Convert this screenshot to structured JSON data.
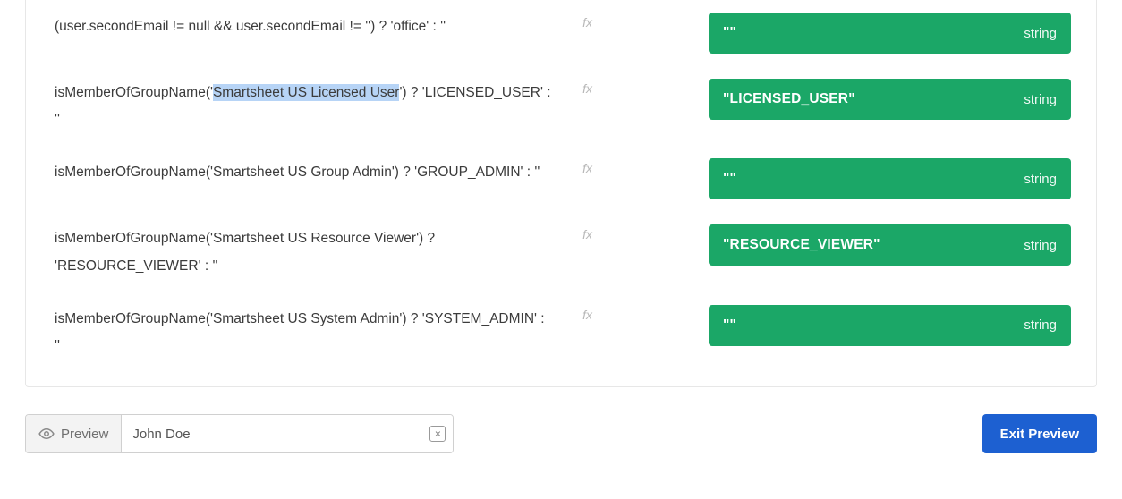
{
  "rows": [
    {
      "expr_pre": "(user.secondEmail != null && user.secondEmail != '') ? 'office' : ''",
      "highlight": "",
      "expr_post": "",
      "fx": "fx",
      "result_value": "\"\"",
      "result_type": "string"
    },
    {
      "expr_pre": "isMemberOfGroupName('",
      "highlight": "Smartsheet US Licensed User",
      "expr_post": "') ? 'LICENSED_USER' : ''",
      "fx": "fx",
      "result_value": "\"LICENSED_USER\"",
      "result_type": "string"
    },
    {
      "expr_pre": "isMemberOfGroupName('Smartsheet US Group Admin') ? 'GROUP_ADMIN' : ''",
      "highlight": "",
      "expr_post": "",
      "fx": "fx",
      "result_value": "\"\"",
      "result_type": "string"
    },
    {
      "expr_pre": "isMemberOfGroupName('Smartsheet US Resource Viewer') ? 'RESOURCE_VIEWER' : ''",
      "highlight": "",
      "expr_post": "",
      "fx": "fx",
      "result_value": "\"RESOURCE_VIEWER\"",
      "result_type": "string"
    },
    {
      "expr_pre": "isMemberOfGroupName('Smartsheet US System Admin') ? 'SYSTEM_ADMIN' : ''",
      "highlight": "",
      "expr_post": "",
      "fx": "fx",
      "result_value": "\"\"",
      "result_type": "string"
    }
  ],
  "bottom": {
    "preview_label": "Preview",
    "preview_value": "John Doe",
    "clear_glyph": "×",
    "exit_label": "Exit Preview"
  }
}
